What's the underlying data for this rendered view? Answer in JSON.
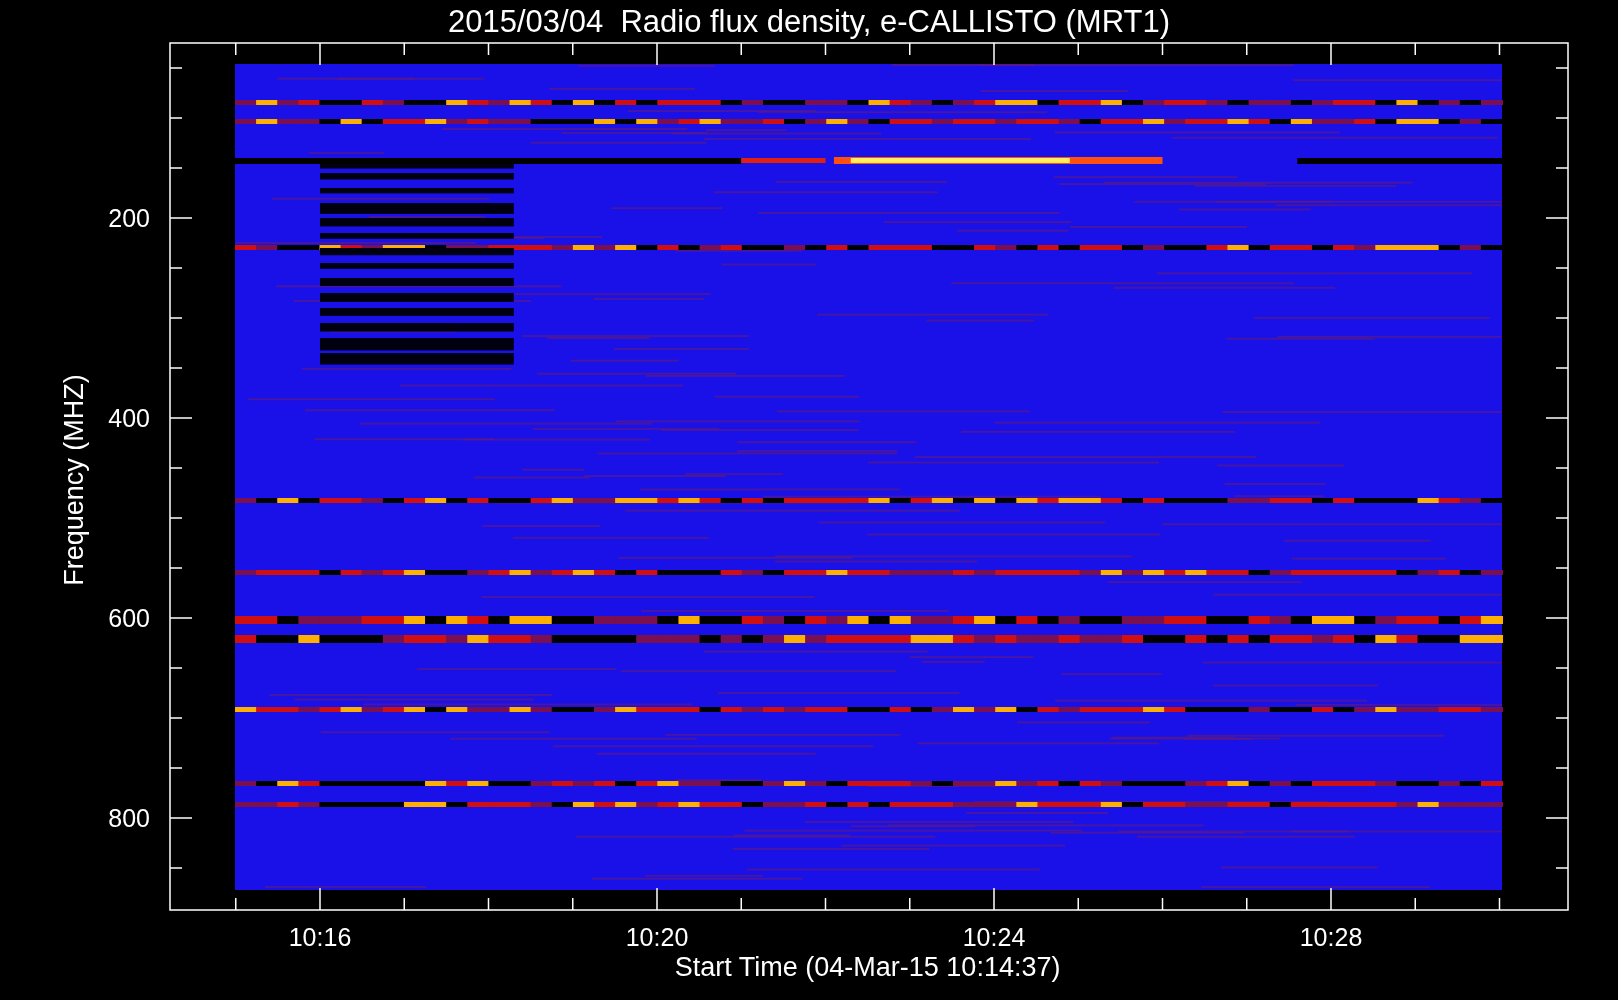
{
  "title": "2015/03/04  Radio flux density, e-CALLISTO (MRT1)",
  "y_axis": {
    "label": "Frequency (MHZ)",
    "tick_labels": [
      "200",
      "400",
      "600",
      "800"
    ]
  },
  "x_axis": {
    "label": "Start Time (04-Mar-15 10:14:37)",
    "tick_labels": [
      "10:16",
      "10:20",
      "10:24",
      "10:28"
    ]
  }
}
